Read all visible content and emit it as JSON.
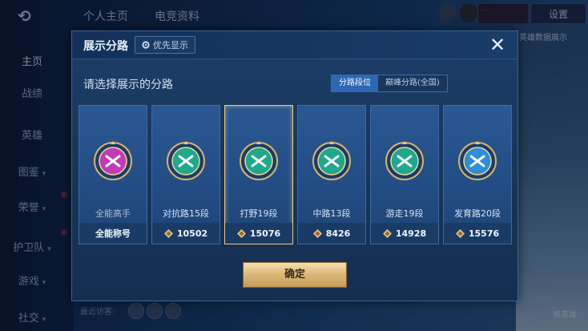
{
  "background": {
    "top_nav": [
      "个人主页",
      "电竞资料"
    ],
    "sidebar": [
      {
        "label": "主页",
        "chevron": false,
        "active": true
      },
      {
        "label": "战绩",
        "chevron": false
      },
      {
        "label": "英雄",
        "chevron": false
      },
      {
        "label": "图鉴",
        "chevron": true
      },
      {
        "label": "荣誉",
        "chevron": true
      },
      {
        "label": "护卫队",
        "chevron": true
      },
      {
        "label": "游戏",
        "chevron": true
      },
      {
        "label": "社交",
        "chevron": true
      }
    ],
    "new_badge": "新",
    "settings_label": "设置",
    "notification_text": "...",
    "hero_tag": "英雄数据展示",
    "recent_visitors": "最近访客:",
    "change_hero_label": "换英雄"
  },
  "modal": {
    "title": "展示分路",
    "priority_label": "优先显示",
    "close_symbol": "✕",
    "subtitle": "请选择展示的分路",
    "tabs": [
      {
        "label": "分路段位",
        "active": true
      },
      {
        "label": "巅峰分路(全国)",
        "active": false
      }
    ],
    "confirm_label": "确定"
  },
  "lanes": [
    {
      "name": "全能高手",
      "value": "全能称号",
      "badge": "allround-badge-icon",
      "color": "#c23bb5",
      "selected": false,
      "has_points_icon": false
    },
    {
      "name": "对抗路15段",
      "value": "10502",
      "badge": "clash-lane-badge-icon",
      "color": "#1fa88a",
      "selected": false,
      "has_points_icon": true
    },
    {
      "name": "打野19段",
      "value": "15076",
      "badge": "jungle-badge-icon",
      "color": "#1fa88a",
      "selected": true,
      "has_points_icon": true
    },
    {
      "name": "中路13段",
      "value": "8426",
      "badge": "mid-lane-badge-icon",
      "color": "#1fa88a",
      "selected": false,
      "has_points_icon": true
    },
    {
      "name": "游走19段",
      "value": "14928",
      "badge": "roam-badge-icon",
      "color": "#1fa88a",
      "selected": false,
      "has_points_icon": true
    },
    {
      "name": "发育路20段",
      "value": "15576",
      "badge": "farm-lane-badge-icon",
      "color": "#2d8fd6",
      "selected": false,
      "has_points_icon": true
    }
  ]
}
